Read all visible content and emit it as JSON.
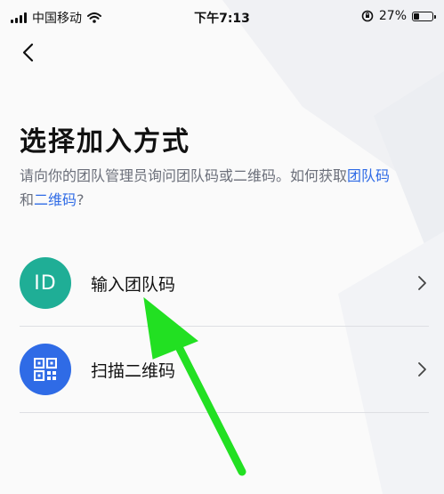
{
  "status_bar": {
    "carrier": "中国移动",
    "time": "下午7:13",
    "battery_percent": "27%",
    "battery_level": 0.27
  },
  "header": {
    "title": "选择加入方式",
    "subtitle_text": "请向你的团队管理员询问团队码或二维码。如何获取",
    "subtitle_link1": "团队码",
    "subtitle_and": "和",
    "subtitle_link2": "二维码",
    "subtitle_end": "?"
  },
  "options": [
    {
      "icon_text": "ID",
      "label": "输入团队码",
      "color": "#1fae96"
    },
    {
      "icon": "qr-code-icon",
      "label": "扫描二维码",
      "color": "#2f6be6"
    }
  ],
  "annotation": {
    "arrow_color": "#22e022"
  }
}
